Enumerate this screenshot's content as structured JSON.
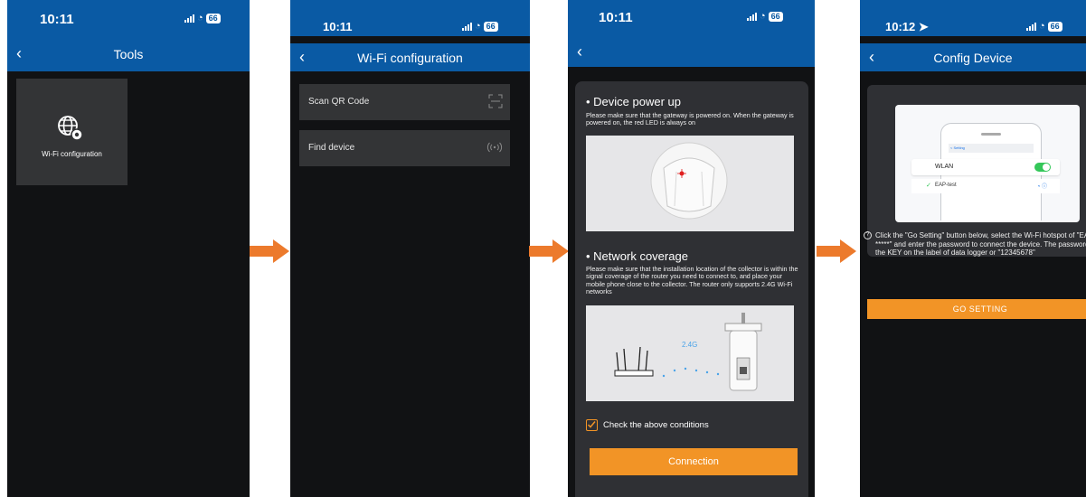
{
  "colors": {
    "nav": "#0a5aa4",
    "bg": "#111214",
    "card": "#2f3034",
    "accent": "#f29426",
    "arrow": "#ec7a2c"
  },
  "phones": [
    {
      "time": "10:11",
      "battery": "66",
      "title": "Tools"
    },
    {
      "time": "10:11",
      "battery": "66",
      "title": "Wi-Fi configuration"
    },
    {
      "time": "10:11",
      "battery": "66",
      "title": ""
    },
    {
      "time": "10:12",
      "battery": "66",
      "title": "Config Device"
    }
  ],
  "tools": {
    "tile_label": "Wi-Fi configuration"
  },
  "wifi": {
    "items": [
      {
        "label": "Scan QR Code",
        "icon": "scan-icon"
      },
      {
        "label": "Find device",
        "icon": "signal-icon"
      }
    ]
  },
  "checklist": {
    "section1_title": "• Device power up",
    "section1_text": "Please make sure that the gateway is powered on. When the gateway is powered on, the red LED is always on",
    "section2_title": "• Network coverage",
    "section2_text": "Please make sure that the installation location of the collector is within the signal coverage of the router you need to connect to, and place your mobile phone close to the collector. The router only supports 2.4G Wi-Fi networks",
    "band_label": "2.4G",
    "check_label": "Check the above conditions",
    "checked": true,
    "button": "Connection"
  },
  "config": {
    "mock_back": "< Setting",
    "mock_row1": "WLAN",
    "mock_row2": "EAP-test",
    "tip": "Click the \"Go Setting\" button below, select the Wi-Fi hotspot of \"EAP-*****\" and enter the password to connect the device. The password is the KEY on the label of data logger or \"12345678\"",
    "button": "GO SETTING"
  }
}
